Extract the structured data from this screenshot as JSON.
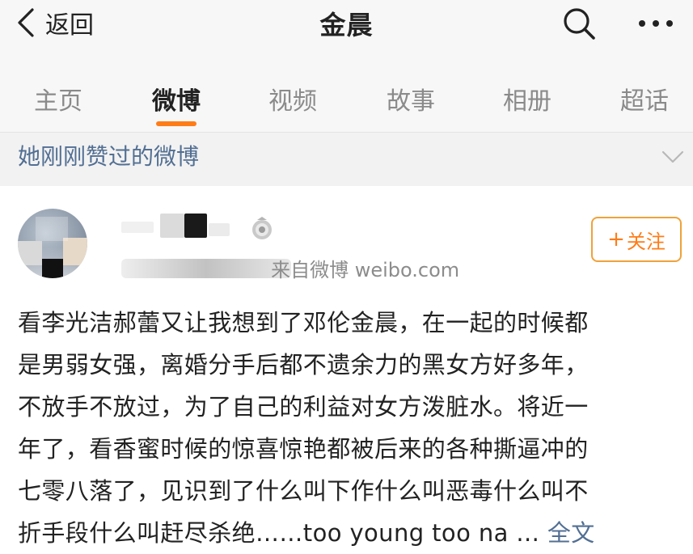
{
  "nav": {
    "back_label": "返回",
    "title": "金晨",
    "icons": {
      "search": "search-icon",
      "more": "more-icon",
      "back": "chevron-left-icon"
    }
  },
  "tabs": [
    {
      "label": "主页",
      "active": false
    },
    {
      "label": "微博",
      "active": true
    },
    {
      "label": "视频",
      "active": false
    },
    {
      "label": "故事",
      "active": false
    },
    {
      "label": "相册",
      "active": false
    },
    {
      "label": "超话",
      "active": false
    }
  ],
  "liked_bar": {
    "label": "她刚刚赞过的微博"
  },
  "post": {
    "source": "来自微博 weibo.com",
    "follow_label": "关注",
    "lines": [
      "看李光洁郝蕾又让我想到了邓伦金晨，在一起的时候都",
      "是男弱女强，离婚分手后都不遗余力的黑女方好多年，",
      "不放手不放过，为了自己的利益对女方泼脏水。将近一",
      "年了，看香蜜时候的惊喜惊艳都被后来的各种撕逼冲的",
      "七零八落了，见识到了什么叫下作什么叫恶毒什么叫不",
      "折手段什么叫赶尽杀绝……too young too na ..."
    ],
    "full_text_label": "全文"
  },
  "colors": {
    "accent": "#ff7c17",
    "link": "#526f93",
    "header_bg": "#f7f7f7"
  }
}
